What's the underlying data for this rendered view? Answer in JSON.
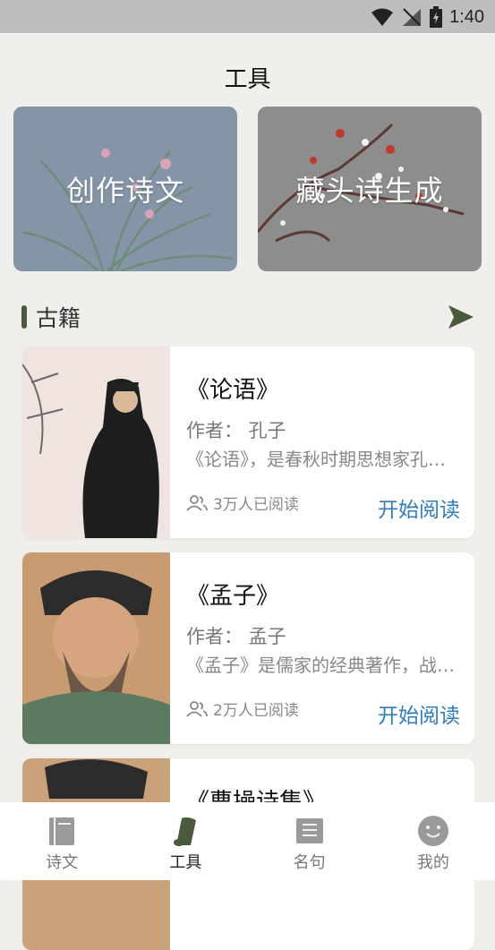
{
  "status_bar": {
    "time": "1:40"
  },
  "header": {
    "title": "工具"
  },
  "tools": [
    {
      "label": "创作诗文"
    },
    {
      "label": "藏头诗生成"
    }
  ],
  "section": {
    "title": "古籍"
  },
  "books": [
    {
      "title": "《论语》",
      "author": "作者：  孔子",
      "desc": "《论语》，是春秋时期思想家孔子及其弟子的言行汇编",
      "readers": "3万人已阅读",
      "action": "开始阅读"
    },
    {
      "title": "《孟子》",
      "author": "作者：  孟子",
      "desc": "《孟子》是儒家的经典著作，战国中期孟子及其弟子所作",
      "readers": "2万人已阅读",
      "action": "开始阅读"
    },
    {
      "title": "《曹操诗集》"
    }
  ],
  "nav": [
    {
      "label": "诗文"
    },
    {
      "label": "工具"
    },
    {
      "label": "名句"
    },
    {
      "label": "我的"
    }
  ]
}
